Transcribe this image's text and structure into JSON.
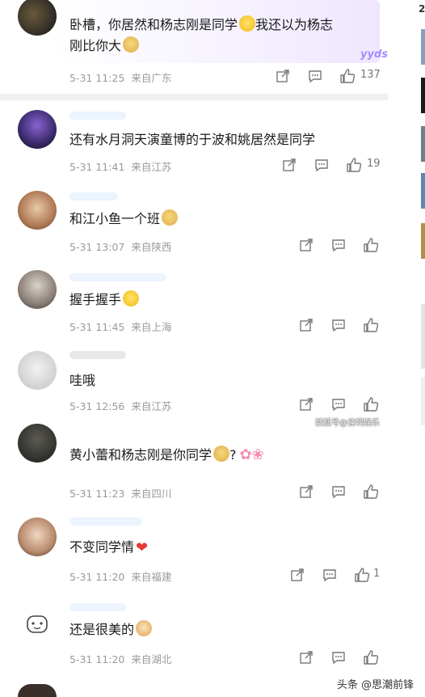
{
  "comments": [
    {
      "text": "卧槽，你居然和杨志刚是同学",
      "text2": "我还以为杨志",
      "text3": "刚比你大",
      "date": "5-31 11:25",
      "loc": "来自广东",
      "likes": "137"
    },
    {
      "text": "还有水月洞天演童博的于波和姚居然是同学",
      "date": "5-31 11:41",
      "loc": "来自江苏",
      "likes": "19"
    },
    {
      "text": "和江小鱼一个班",
      "date": "5-31 13:07",
      "loc": "来自陕西",
      "likes": ""
    },
    {
      "text": "握手握手",
      "date": "5-31 11:45",
      "loc": "来自上海",
      "likes": ""
    },
    {
      "text": "哇哦",
      "date": "5-31 12:56",
      "loc": "来自江苏",
      "likes": ""
    },
    {
      "text": "黄小蕾和杨志刚是你同学",
      "text2": "?",
      "date": "5-31 11:23",
      "loc": "来自四川",
      "likes": ""
    },
    {
      "text": "不变同学情",
      "date": "5-31 11:20",
      "loc": "来自福建",
      "likes": "1"
    },
    {
      "text": "还是很美的",
      "date": "5-31 11:20",
      "loc": "来自湖北",
      "likes": ""
    }
  ],
  "stickers": {
    "yyds": "yyds"
  },
  "watermarks": {
    "mid": "搜狐号@佳明娱乐",
    "footer": "头条 @思潮前锋"
  },
  "right_strip": {
    "digit": "2"
  },
  "icons": [
    "share-icon",
    "comment-icon",
    "like-icon"
  ],
  "colors": {
    "meta": "#9a9a9a",
    "divider": "#f0f0f0",
    "heart": "#e53935",
    "highlight": "#efe6ff"
  }
}
